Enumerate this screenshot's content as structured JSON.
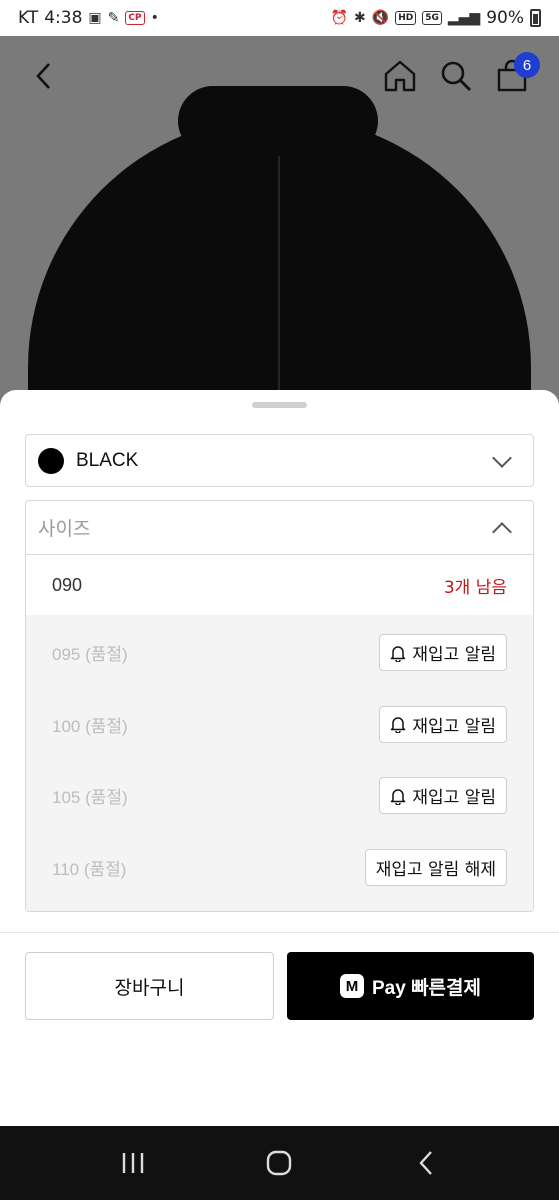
{
  "status_bar": {
    "carrier": "KT",
    "time": "4:38",
    "cp_label": "CP",
    "hd_label": "HD",
    "network_label": "5G",
    "battery": "90%"
  },
  "header": {
    "cart_count": "6",
    "icons": [
      "back-arrow-icon",
      "home-icon",
      "search-icon",
      "shopping-bag-icon"
    ]
  },
  "color_option": {
    "selected": "BLACK",
    "swatch_color": "#000000"
  },
  "size_option": {
    "placeholder": "사이즈",
    "available": {
      "size": "090",
      "stock_text": "3개 남음"
    },
    "sold_out": [
      {
        "size": "095 (품절)",
        "action": "재입고 알림"
      },
      {
        "size": "100 (품절)",
        "action": "재입고 알림"
      },
      {
        "size": "105 (품절)",
        "action": "재입고 알림"
      },
      {
        "size": "110 (품절)",
        "action": "재입고 알림 해제"
      }
    ]
  },
  "actions": {
    "cart_label": "장바구니",
    "pay_logo": "M",
    "pay_label": "Pay 빠른결제"
  },
  "colors": {
    "accent_red": "#c4161c",
    "badge_blue": "#1f3fd1",
    "pay_bg": "#000000"
  }
}
